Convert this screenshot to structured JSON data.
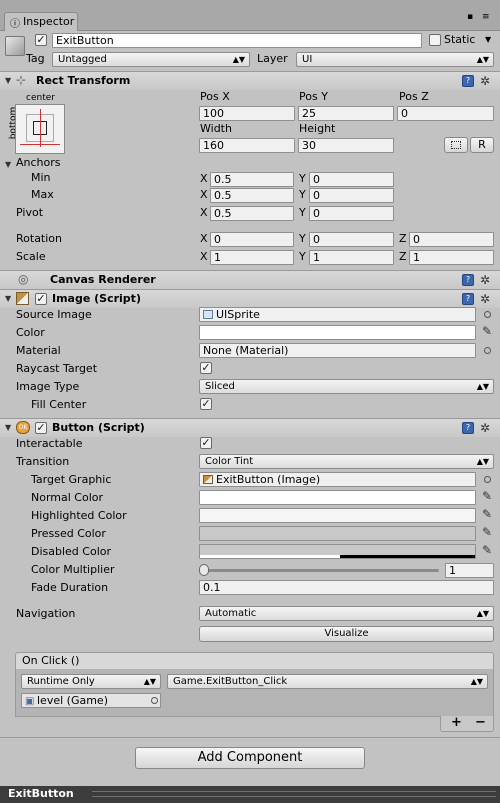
{
  "tab": {
    "title": "Inspector"
  },
  "object": {
    "name": "ExitButton",
    "active": true,
    "static_label": "Static",
    "tag_label": "Tag",
    "tag_value": "Untagged",
    "layer_label": "Layer",
    "layer_value": "UI"
  },
  "rect_transform": {
    "title": "Rect Transform",
    "anchor_preset_top": "center",
    "anchor_preset_side": "bottom",
    "col_labels": [
      "Pos X",
      "Pos Y",
      "Pos Z",
      "Width",
      "Height"
    ],
    "pos_x": "100",
    "pos_y": "25",
    "pos_z": "0",
    "width": "160",
    "height": "30",
    "reset_button": "R",
    "anchors_label": "Anchors",
    "min_label": "Min",
    "min_x": "0.5",
    "min_y": "0",
    "max_label": "Max",
    "max_x": "0.5",
    "max_y": "0",
    "pivot_label": "Pivot",
    "pivot_x": "0.5",
    "pivot_y": "0",
    "rotation_label": "Rotation",
    "rot_x": "0",
    "rot_y": "0",
    "rot_z": "0",
    "scale_label": "Scale",
    "scale_x": "1",
    "scale_y": "1",
    "scale_z": "1",
    "axis_x": "X",
    "axis_y": "Y",
    "axis_z": "Z"
  },
  "canvas_renderer": {
    "title": "Canvas Renderer"
  },
  "image_script": {
    "title": "Image (Script)",
    "source_image_label": "Source Image",
    "source_image_value": "UISprite",
    "color_label": "Color",
    "material_label": "Material",
    "material_value": "None (Material)",
    "raycast_label": "Raycast Target",
    "image_type_label": "Image Type",
    "image_type_value": "Sliced",
    "fill_center_label": "Fill Center"
  },
  "button_script": {
    "title": "Button (Script)",
    "interactable_label": "Interactable",
    "transition_label": "Transition",
    "transition_value": "Color Tint",
    "target_graphic_label": "Target Graphic",
    "target_graphic_value": "ExitButton (Image)",
    "normal_color_label": "Normal Color",
    "highlighted_color_label": "Highlighted Color",
    "pressed_color_label": "Pressed Color",
    "disabled_color_label": "Disabled Color",
    "color_multiplier_label": "Color Multiplier",
    "color_multiplier_value": "1",
    "fade_duration_label": "Fade Duration",
    "fade_duration_value": "0.1",
    "navigation_label": "Navigation",
    "navigation_value": "Automatic",
    "visualize_button": "Visualize",
    "onclick_label": "On Click ()",
    "runtime_value": "Runtime Only",
    "function_value": "Game.ExitButton_Click",
    "object_value": "level (Game)",
    "add_label": "+",
    "remove_label": "−"
  },
  "add_component": {
    "label": "Add Component"
  },
  "footer": {
    "label": "ExitButton"
  }
}
